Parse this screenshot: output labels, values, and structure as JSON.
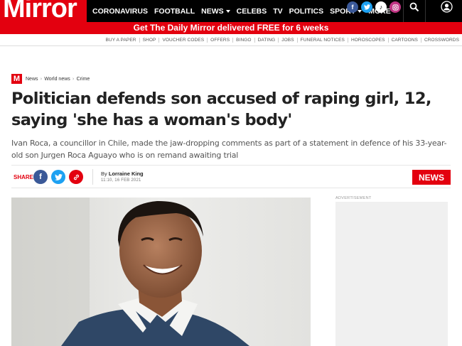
{
  "brand": {
    "logo": "Mirror",
    "red": "#e3000f"
  },
  "nav": {
    "items": [
      {
        "label": "CORONAVIRUS",
        "dropdown": false
      },
      {
        "label": "FOOTBALL",
        "dropdown": false
      },
      {
        "label": "NEWS",
        "dropdown": true
      },
      {
        "label": "CELEBS",
        "dropdown": false
      },
      {
        "label": "TV",
        "dropdown": false
      },
      {
        "label": "POLITICS",
        "dropdown": false
      },
      {
        "label": "SPORT",
        "dropdown": true
      },
      {
        "label": "MORE",
        "dropdown": true
      }
    ],
    "social_icons": [
      "facebook-icon",
      "twitter-icon",
      "tiktok-icon",
      "instagram-icon"
    ],
    "search_icon": "search-icon",
    "account_icon": "user-icon"
  },
  "promo": {
    "text": "Get The Daily Mirror delivered FREE for 6 weeks"
  },
  "subnav": [
    "BUY A PAPER",
    "SHOP",
    "VOUCHER CODES",
    "OFFERS",
    "BINGO",
    "DATING",
    "JOBS",
    "FUNERAL NOTICES",
    "HOROSCOPES",
    "CARTOONS",
    "CROSSWORDS"
  ],
  "breadcrumb": {
    "badge": "M",
    "items": [
      "News",
      "World news",
      "Crime"
    ]
  },
  "article": {
    "headline": "Politician defends son accused of raping girl, 12, saying 'she has a woman's body'",
    "standfirst": "Ivan Roca, a councillor in Chile, made the jaw-dropping comments as part of a statement in defence of his 33-year-old son Jurgen Roca Aguayo who is on remand awaiting trial",
    "share_label": "SHARE",
    "byline_prefix": "By",
    "author": "Lorraine King",
    "date": "11:10, 16 FEB 2021",
    "section_badge": "NEWS"
  },
  "ad": {
    "label": "ADVERTISEMENT"
  }
}
